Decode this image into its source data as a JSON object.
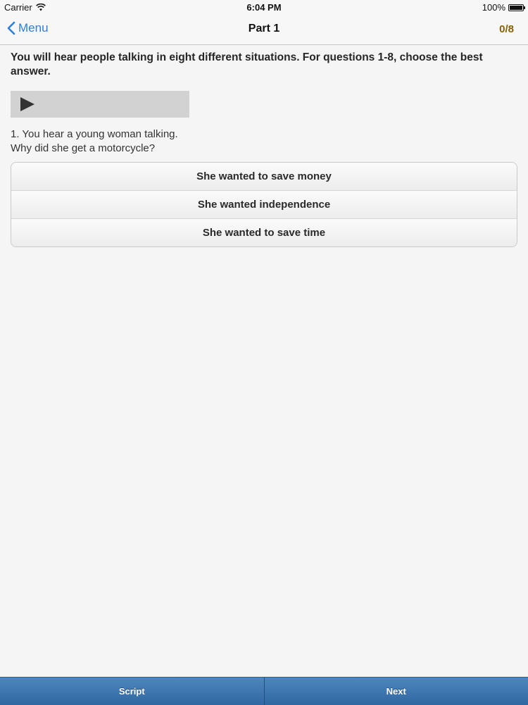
{
  "status_bar": {
    "carrier": "Carrier",
    "time": "6:04 PM",
    "battery": "100%"
  },
  "nav": {
    "back_label": "Menu",
    "title": "Part 1",
    "score": "0/8"
  },
  "instructions": "You will hear people talking in eight different situations. For questions 1-8, choose the best answer.",
  "question": {
    "line1": "1. You hear a young woman talking.",
    "line2": "Why did she get a motorcycle?"
  },
  "answers": [
    "She wanted to save money",
    "She wanted independence",
    "She wanted to save time"
  ],
  "toolbar": {
    "script_label": "Script",
    "next_label": "Next"
  },
  "colors": {
    "accent": "#2f7ed6",
    "score": "#8a6100",
    "toolbar": "#3a72ac"
  }
}
